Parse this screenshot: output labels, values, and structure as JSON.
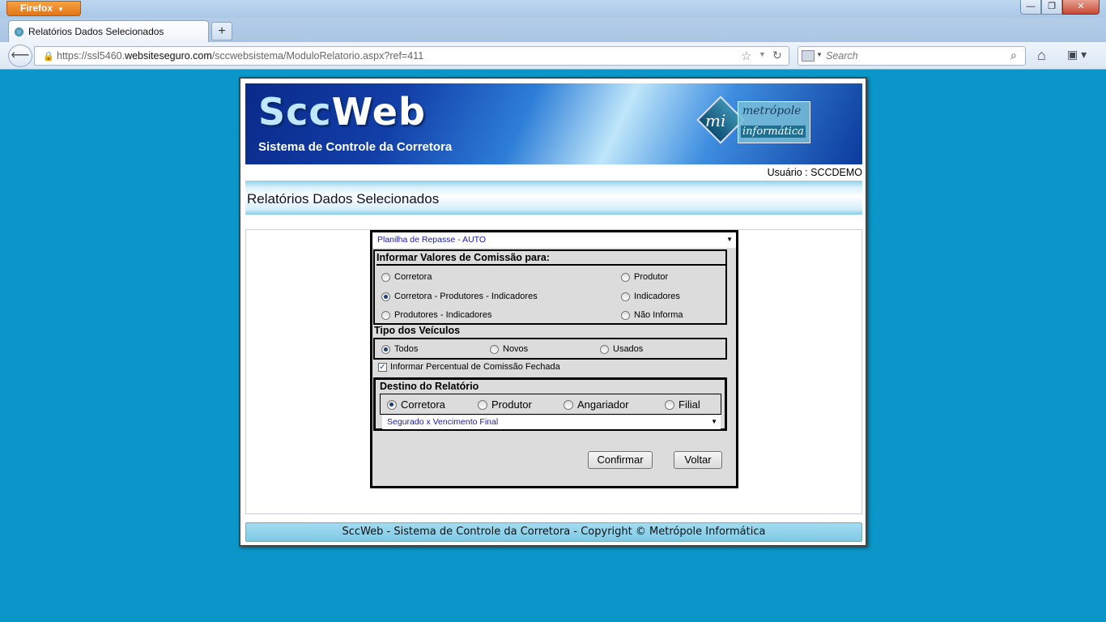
{
  "browser": {
    "app_button": "Firefox",
    "tab_title": "Relatórios Dados Selecionados",
    "new_tab": "+",
    "url_prefix": "https://ssl5460.",
    "url_domain": "websiteseguro.com",
    "url_path": "/sccwebsistema/ModuloRelatorio.aspx?ref=411",
    "search_placeholder": "Search"
  },
  "banner": {
    "title_a": "Scc",
    "title_b": "Web",
    "subtitle": "Sistema de Controle da Corretora",
    "logo_top": "metrópole",
    "logo_bottom": "informática",
    "logo_mark": "mi"
  },
  "user_line": "Usuário : SCCDEMO",
  "page_title": "Relatórios Dados Selecionados",
  "form": {
    "report_select": "Planilha de Repasse - AUTO",
    "commission_group": {
      "title": "Informar Valores de Comissão para:",
      "options": [
        "Corretora",
        "Produtor",
        "Corretora - Produtores - Indicadores",
        "Indicadores",
        "Produtores - Indicadores",
        "Não Informa"
      ],
      "selected": "Corretora - Produtores - Indicadores"
    },
    "vehicle_group": {
      "title": "Tipo dos Veículos",
      "options": [
        "Todos",
        "Novos",
        "Usados"
      ],
      "selected": "Todos"
    },
    "closed_commission_checkbox": "Informar Percentual de Comissão Fechada",
    "destination_group": {
      "title": "Destino do Relatório",
      "options": [
        "Corretora",
        "Produtor",
        "Angariador",
        "Filial"
      ],
      "selected": "Corretora"
    },
    "order_select": "Segurado x Vencimento Final",
    "confirm_label": "Confirmar",
    "back_label": "Voltar"
  },
  "footer": "SccWeb - Sistema de Controle da Corretora - Copyright © Metrópole Informática"
}
